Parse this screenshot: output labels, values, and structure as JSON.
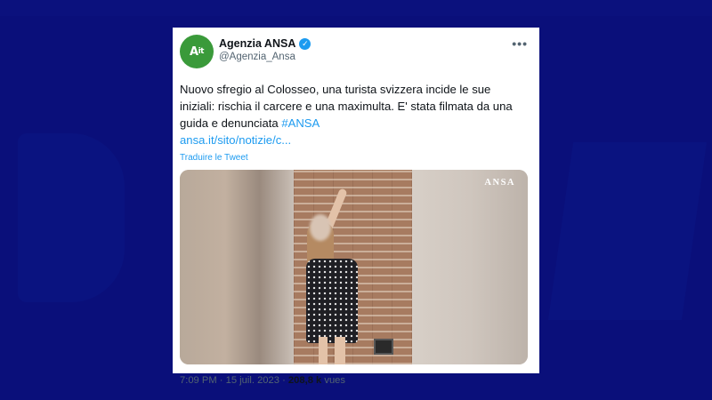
{
  "tweet": {
    "avatar_text": "A",
    "avatar_sup": "it",
    "display_name": "Agenzia ANSA",
    "verified_glyph": "✓",
    "handle": "@Agenzia_Ansa",
    "more_glyph": "•••",
    "text": "Nuovo sfregio al Colosseo, una turista svizzera incide le sue iniziali: rischia il carcere e una maximulta. E' stata filmata da una guida e denunciata ",
    "hashtag": "#ANSA",
    "link": "ansa.it/sito/notizie/c...",
    "translate": "Traduire le Tweet",
    "media_logo": "ANSA",
    "time": "7:09 PM",
    "separator": " · ",
    "date": "15 juil. 2023",
    "views_count": "208,8 k",
    "views_label": " vues"
  },
  "colors": {
    "background": "#0a0f7a",
    "link": "#1d9bf0",
    "avatar": "#3a9a3a"
  },
  "icons": [
    "verified-icon",
    "more-icon"
  ]
}
